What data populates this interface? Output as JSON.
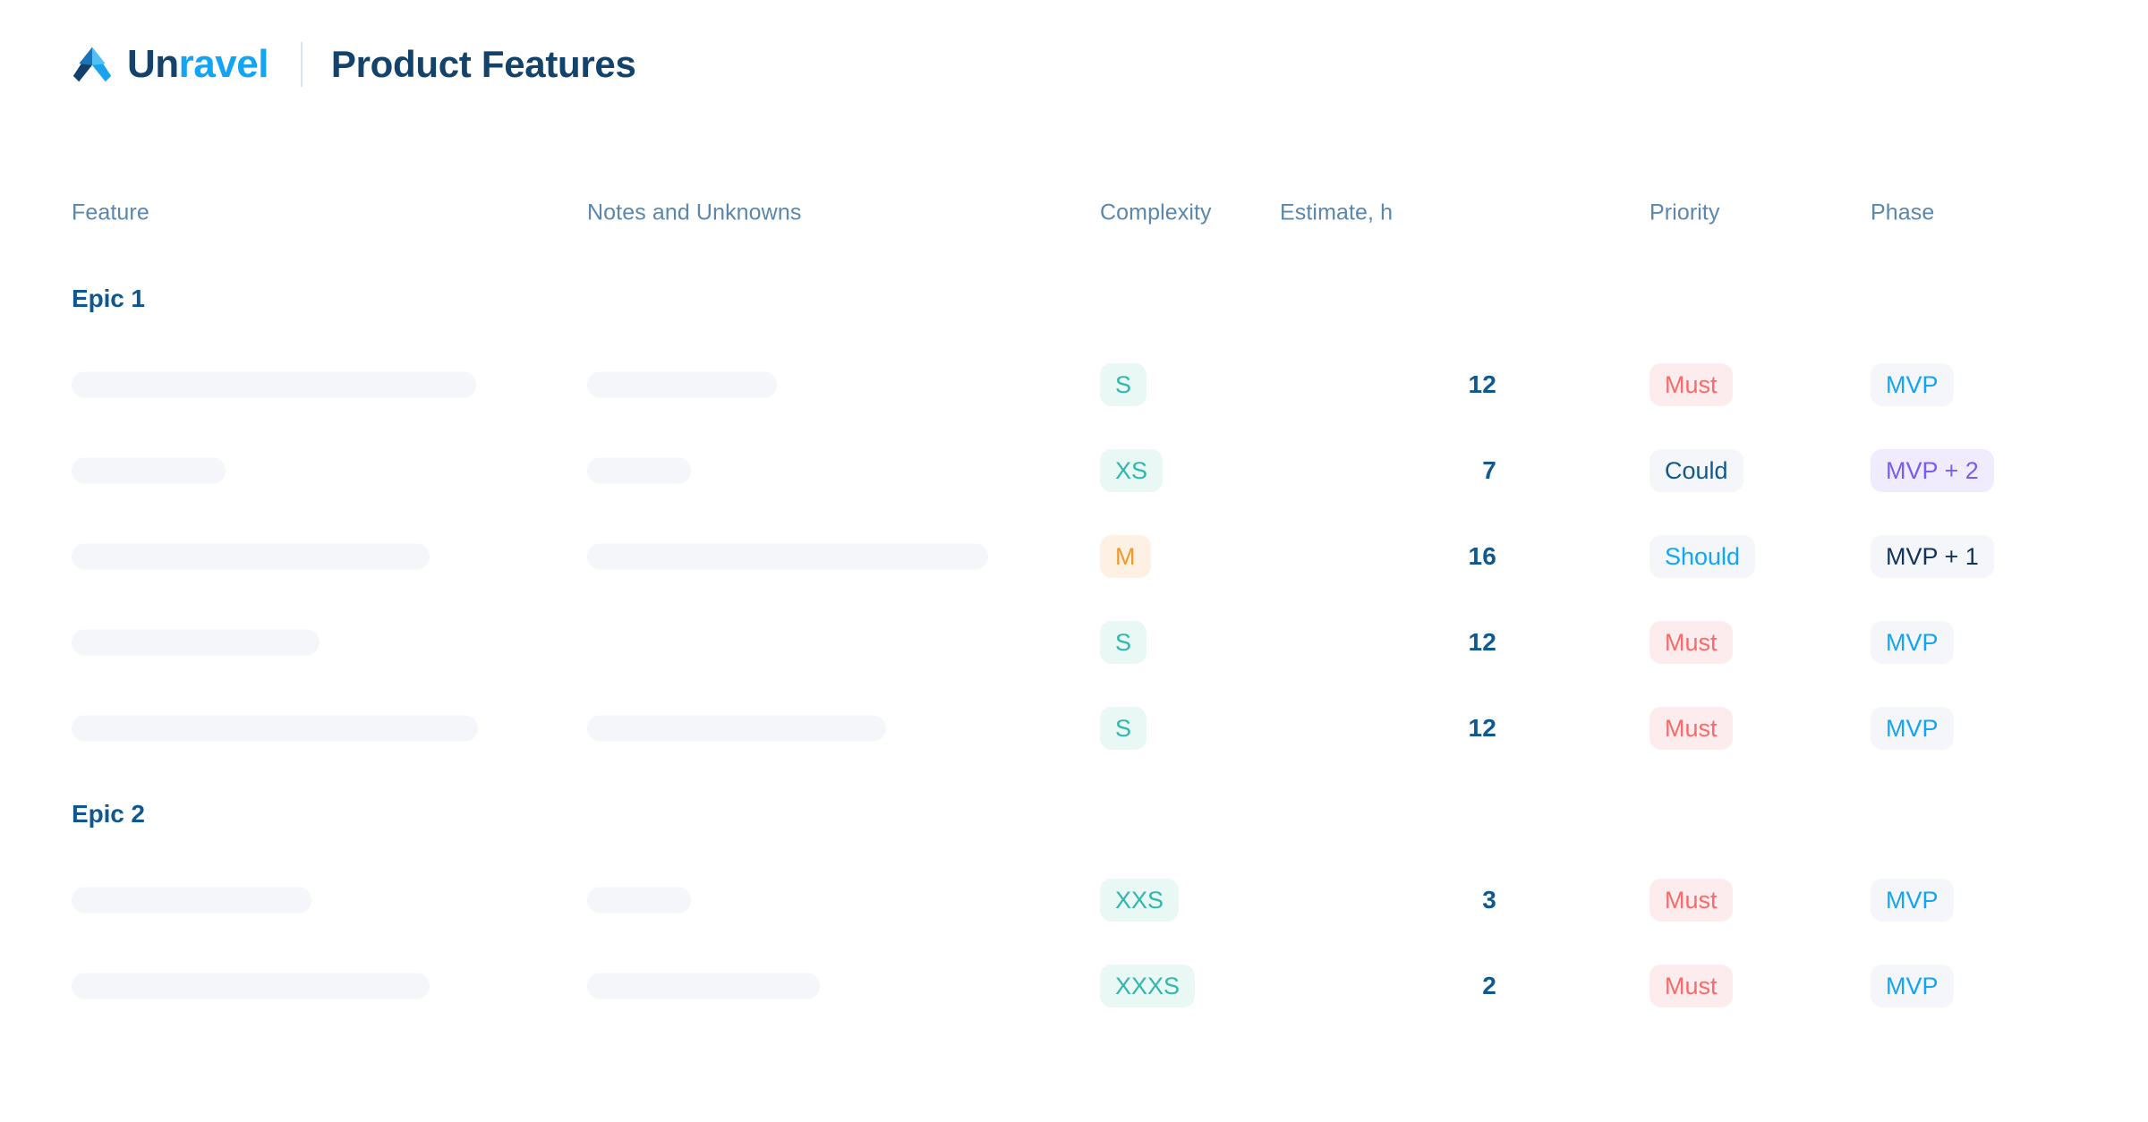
{
  "brand": {
    "logo_icon": "unravel-triangle-logo-icon",
    "name_first": "Un",
    "name_second": "ravel",
    "name_full": "Unravel",
    "color_dark": "#13426b",
    "color_light": "#13a5f5"
  },
  "header": {
    "page_title": "Product Features"
  },
  "columns": [
    {
      "key": "feature",
      "label": "Feature"
    },
    {
      "key": "notes",
      "label": "Notes and Unknowns"
    },
    {
      "key": "complexity",
      "label": "Complexity"
    },
    {
      "key": "estimate",
      "label": "Estimate, h"
    },
    {
      "key": "priority",
      "label": "Priority"
    },
    {
      "key": "phase",
      "label": "Phase"
    }
  ],
  "styles": {
    "complexity": {
      "S": {
        "bg": "#e9f7f5",
        "fg": "#2fb8ab"
      },
      "XS": {
        "bg": "#e9f7f5",
        "fg": "#2fb8ab"
      },
      "XXS": {
        "bg": "#e9f7f5",
        "fg": "#2fb8ab"
      },
      "XXXS": {
        "bg": "#e9f7f5",
        "fg": "#2fb8ab"
      },
      "M": {
        "bg": "#fdf1e4",
        "fg": "#f0992e"
      }
    },
    "priority": {
      "Must": {
        "bg": "#fdeced",
        "fg": "#fa6a6a"
      },
      "Should": {
        "bg": "#f4f6f9",
        "fg": "#13a5f5"
      },
      "Could": {
        "bg": "#f4f6f9",
        "fg": "#11588f"
      }
    },
    "phase": {
      "MVP": {
        "bg": "#f4f6f9",
        "fg": "#13a5f5"
      },
      "MVP + 1": {
        "bg": "#f4f6f9",
        "fg": "#11345c"
      },
      "MVP + 2": {
        "bg": "#f0ebfd",
        "fg": "#7b5cf0"
      }
    },
    "skeleton_color": "#f4f6f9"
  },
  "groups": [
    {
      "title": "Epic 1",
      "rows": [
        {
          "feature_width": 452,
          "notes_width": 212,
          "complexity": "S",
          "estimate": "12",
          "priority": "Must",
          "phase": "MVP"
        },
        {
          "feature_width": 172,
          "notes_width": 116,
          "complexity": "XS",
          "estimate": "7",
          "priority": "Could",
          "phase": "MVP + 2"
        },
        {
          "feature_width": 400,
          "notes_width": 448,
          "complexity": "M",
          "estimate": "16",
          "priority": "Should",
          "phase": "MVP + 1"
        },
        {
          "feature_width": 277,
          "notes_width": 0,
          "complexity": "S",
          "estimate": "12",
          "priority": "Must",
          "phase": "MVP"
        },
        {
          "feature_width": 454,
          "notes_width": 334,
          "complexity": "S",
          "estimate": "12",
          "priority": "Must",
          "phase": "MVP"
        }
      ]
    },
    {
      "title": "Epic 2",
      "rows": [
        {
          "feature_width": 268,
          "notes_width": 116,
          "complexity": "XXS",
          "estimate": "3",
          "priority": "Must",
          "phase": "MVP"
        },
        {
          "feature_width": 400,
          "notes_width": 260,
          "complexity": "XXXS",
          "estimate": "2",
          "priority": "Must",
          "phase": "MVP"
        }
      ]
    }
  ]
}
